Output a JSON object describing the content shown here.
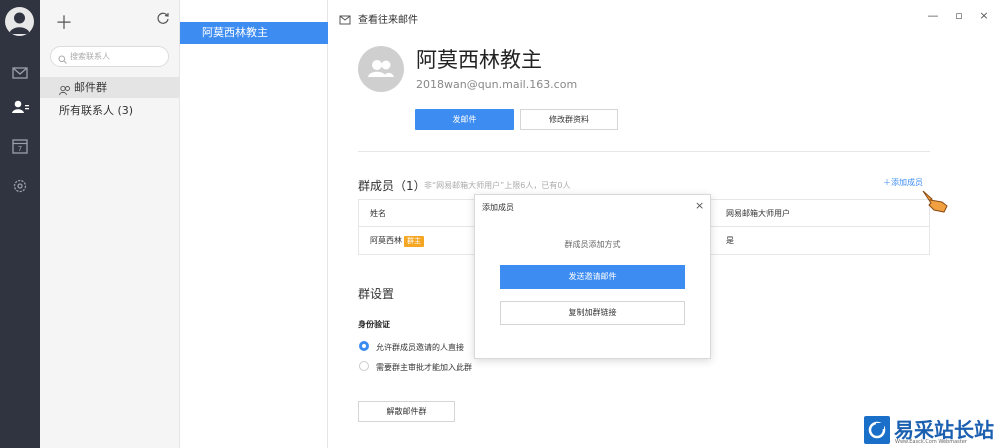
{
  "colors": {
    "accent": "#3d8cf1",
    "rail": "#2f3440",
    "badge": "#f5a623"
  },
  "rail": {
    "icons": [
      "avatar-icon",
      "mail-icon",
      "contacts-icon",
      "calendar-icon",
      "settings-icon"
    ],
    "calendar_day": "7"
  },
  "contacts": {
    "search_placeholder": "搜索联系人",
    "group_label": "邮件群",
    "all_contacts_label": "所有联系人 (3)"
  },
  "group_list": {
    "selected": "阿莫西林教主"
  },
  "topbar": {
    "title": "查看往来邮件"
  },
  "group": {
    "name": "阿莫西林教主",
    "email": "2018wan@qun.mail.163.com",
    "send_mail_label": "发邮件",
    "edit_label": "修改群资料"
  },
  "members": {
    "title": "群成员（1）",
    "note": "非“网易邮箱大师用户”上限6人，已有0人",
    "add_label": "添加成员",
    "col_name": "姓名",
    "col_master": "网易邮箱大师用户",
    "rows": [
      {
        "name": "阿莫西林",
        "badge": "群主",
        "master": "是"
      }
    ]
  },
  "settings": {
    "title": "群设置",
    "auth_title": "身份验证",
    "option1": "允许群成员邀请的人直接",
    "option2": "需要群主审批才能加入此群",
    "dissolve_label": "解散邮件群"
  },
  "modal": {
    "title": "添加成员",
    "subtitle": "群成员添加方式",
    "btn_invite": "发送邀请邮件",
    "btn_copy": "复制加群链接"
  },
  "watermark": {
    "text": "易采站长站",
    "url": "Www.Easck.Com  Webmaster"
  }
}
